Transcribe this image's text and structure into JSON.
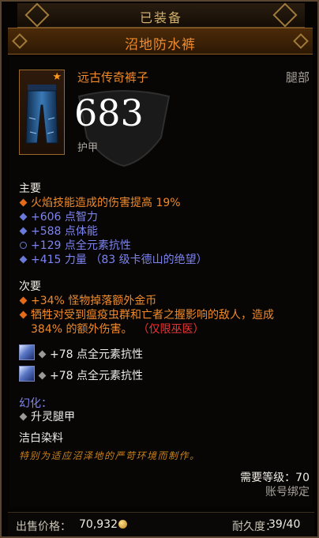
{
  "header": {
    "equipped_label": "已装备",
    "item_name": "沼地防水裤"
  },
  "item": {
    "type": "远古传奇裤子",
    "slot": "腿部",
    "armor_value": "683",
    "armor_label": "护甲",
    "star_icon": "ancient-star-icon",
    "icon": "legendary-pants-icon"
  },
  "primary": {
    "label": "主要",
    "stats": [
      {
        "text": "火焰技能造成的伤害提高 19%",
        "bullet": "orange"
      },
      {
        "text": "+606 点智力",
        "bullet": "blue"
      },
      {
        "text": "+588 点体能",
        "bullet": "blue"
      },
      {
        "text": "+129 点全元素抗性",
        "bullet": "ring"
      },
      {
        "text": "+415 力量 （83 级卡德山的绝望）",
        "bullet": "blue"
      }
    ]
  },
  "secondary": {
    "label": "次要",
    "stats": [
      {
        "text": "+34% 怪物掉落额外金币",
        "bullet": "orange"
      },
      {
        "text_line1": "牺牲对受到瘟疫虫群和亡者之握影响的敌人，造成",
        "text_line2": "384% 的额外伤害。",
        "restriction": "（仅限巫医）",
        "bullet": "orange"
      }
    ]
  },
  "sockets": [
    {
      "text": "+78 点全元素抗性",
      "gem_icon": "diamond-gem-icon"
    },
    {
      "text": "+78 点全元素抗性",
      "gem_icon": "diamond-gem-icon"
    }
  ],
  "transmog": {
    "label": "幻化：",
    "value": "升灵腿甲"
  },
  "dye": "洁白染料",
  "flavor": "特别为适应沼泽地的严苛环境而制作。",
  "requirements": {
    "level_text": "需要等级：70",
    "bound_text": "账号绑定"
  },
  "footer": {
    "price_label": "出售价格：",
    "price_value": "70,932",
    "durability_label": "耐久度：",
    "durability_value": "39/40"
  },
  "colors": {
    "legendary": "#f08a2a",
    "magic": "#7d84ee",
    "restriction": "#ee3333"
  }
}
